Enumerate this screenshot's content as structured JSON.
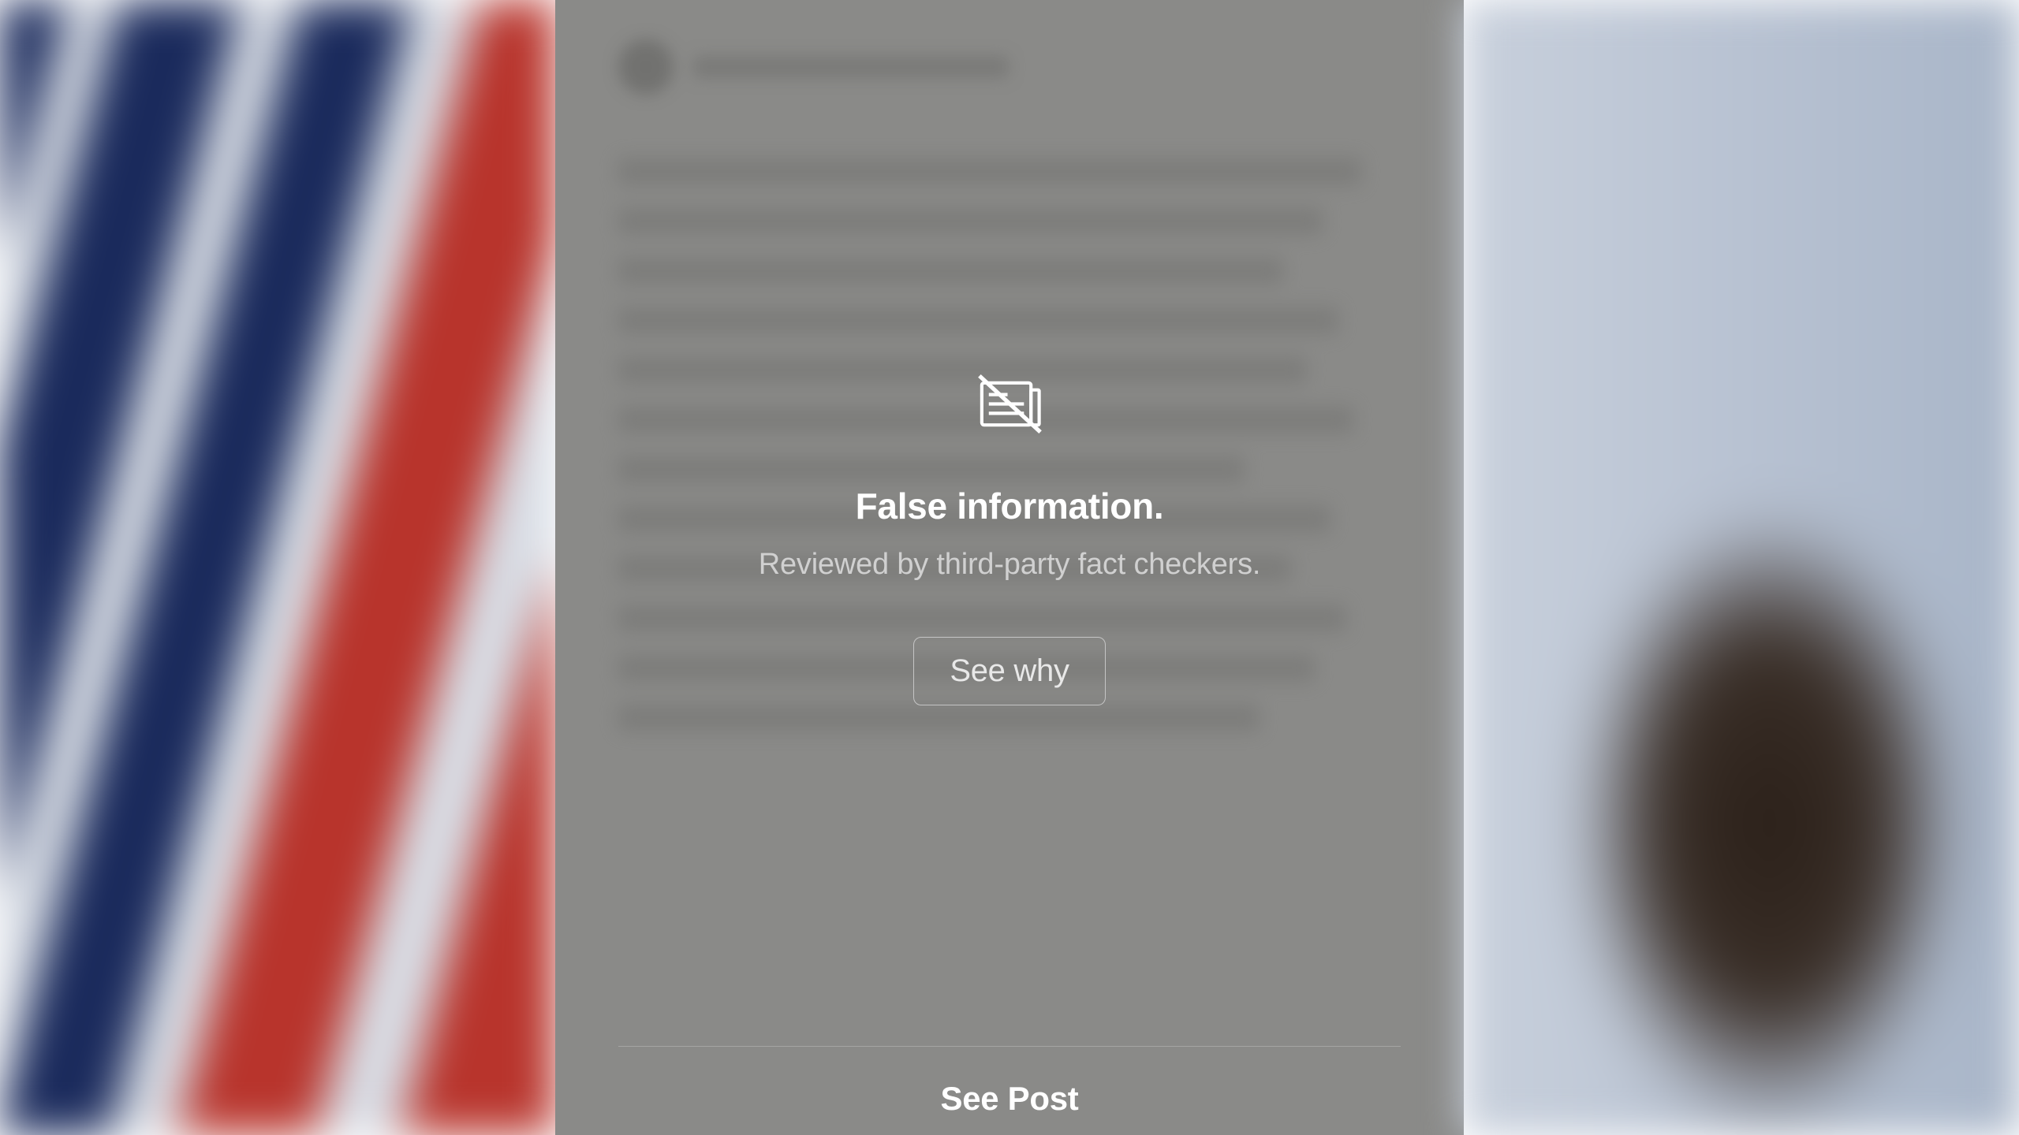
{
  "warning": {
    "title": "False information.",
    "subtitle": "Reviewed by third-party fact checkers.",
    "see_why_label": "See why"
  },
  "footer": {
    "see_post_label": "See Post"
  }
}
